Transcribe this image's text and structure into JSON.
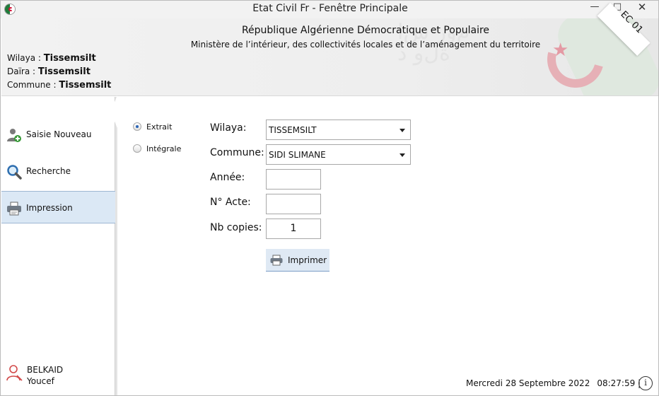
{
  "window": {
    "title": "Etat Civil Fr - Fenêtre Principale",
    "controls": {
      "minimize": "—",
      "maximize": "□",
      "close": "✕"
    }
  },
  "header": {
    "title": "République Algérienne Démocratique et Populaire",
    "subtitle": "Ministère de l’intérieur, des collectivités locales et de l’aménagement du territoire",
    "wilaya_label": "Wilaya : ",
    "wilaya_value": "Tissemsilt",
    "daira_label": "Daïra : ",
    "daira_value": "Tissemsilt",
    "commune_label": "Commune : ",
    "commune_value": "Tissemsilt",
    "badge": "EC 01"
  },
  "sidebar": {
    "items": [
      {
        "label": "Saisie Nouveau",
        "icon": "add-user-icon",
        "active": false
      },
      {
        "label": "Recherche",
        "icon": "search-icon",
        "active": false
      },
      {
        "label": "Impression",
        "icon": "printer-icon",
        "active": true
      }
    ],
    "user": {
      "first_line": "BELKAID",
      "second_line": "Youcef",
      "icon": "user-icon"
    }
  },
  "form": {
    "options": [
      {
        "label": "Extrait",
        "checked": true
      },
      {
        "label": "Intégrale",
        "checked": false
      }
    ],
    "wilaya_label": "Wilaya:",
    "wilaya_value": "TISSEMSILT",
    "commune_label": "Commune:",
    "commune_value": "SIDI SLIMANE",
    "annee_label": "Année:",
    "annee_value": "",
    "acte_label": "N° Acte:",
    "acte_value": "",
    "copies_label": "Nb copies:",
    "copies_value": "1",
    "print_label": "Imprimer"
  },
  "status": {
    "date": "Mercredi 28 Septembre 2022",
    "time": "08:27:59 |",
    "info_icon": "info-icon"
  },
  "colors": {
    "active_nav_bg": "#dbe8f5",
    "print_button_bg": "#dfe9f4",
    "flag_green": "#1f7a3a",
    "flag_red": "#d21034"
  }
}
